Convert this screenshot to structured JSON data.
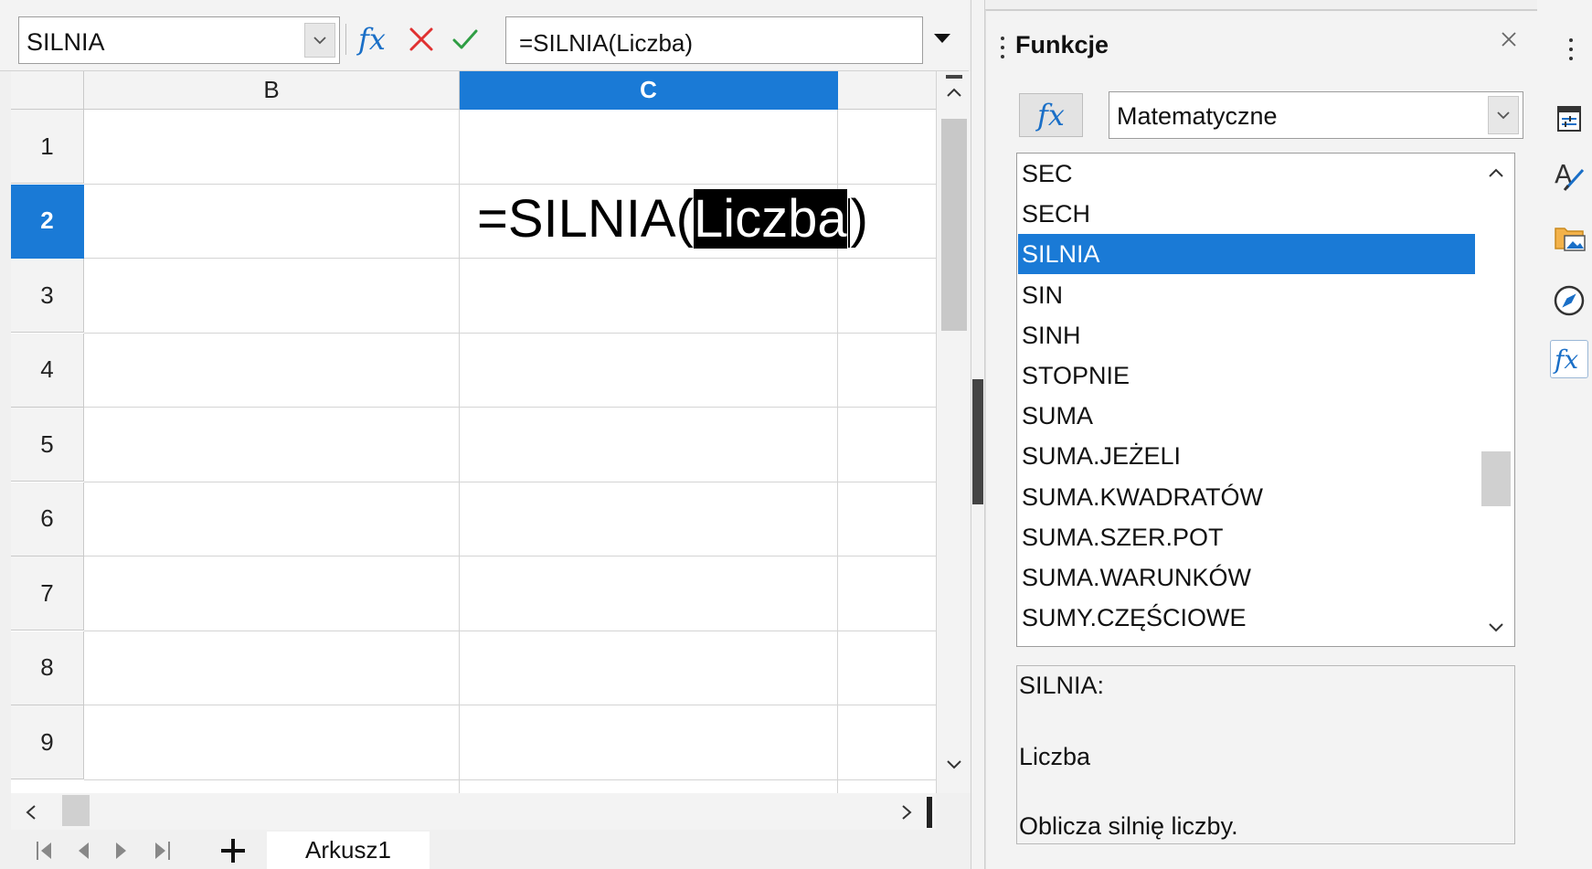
{
  "formula_bar": {
    "name_box": "SILNIA",
    "fx_label": "fx",
    "formula": "=SILNIA(Liczba)"
  },
  "grid": {
    "columns": [
      {
        "label": "B",
        "selected": false
      },
      {
        "label": "C",
        "selected": true
      },
      {
        "label": "",
        "selected": false
      }
    ],
    "rows": [
      {
        "label": "1",
        "selected": false
      },
      {
        "label": "2",
        "selected": true
      },
      {
        "label": "3",
        "selected": false
      },
      {
        "label": "4",
        "selected": false
      },
      {
        "label": "5",
        "selected": false
      },
      {
        "label": "6",
        "selected": false
      },
      {
        "label": "7",
        "selected": false
      },
      {
        "label": "8",
        "selected": false
      },
      {
        "label": "9",
        "selected": false
      }
    ],
    "cell_edit": {
      "prefix": "=SILNIA(",
      "selected_arg": "Liczba",
      "suffix": ")"
    }
  },
  "sheet_tabs": {
    "active": "Arkusz1"
  },
  "functions_panel": {
    "title": "Funkcje",
    "insert_label": "fx",
    "category": "Matematyczne",
    "items": [
      "SEC",
      "SECH",
      "SILNIA",
      "SIN",
      "SINH",
      "STOPNIE",
      "SUMA",
      "SUMA.JEŻELI",
      "SUMA.KWADRATÓW",
      "SUMA.SZER.POT",
      "SUMA.WARUNKÓW",
      "SUMY.CZĘŚCIOWE"
    ],
    "selected_index": 2,
    "description": {
      "name": "SILNIA:",
      "argument": "Liczba",
      "text": "Oblicza silnię liczby."
    }
  },
  "sidebar_tabs": [
    "properties-icon",
    "styles-icon",
    "gallery-icon",
    "navigator-icon",
    "functions-icon"
  ],
  "colors": {
    "accent": "#1a7ad6",
    "fx_blue": "#1a6fc7",
    "cancel_red": "#e03131",
    "accept_green": "#2f9e44"
  }
}
